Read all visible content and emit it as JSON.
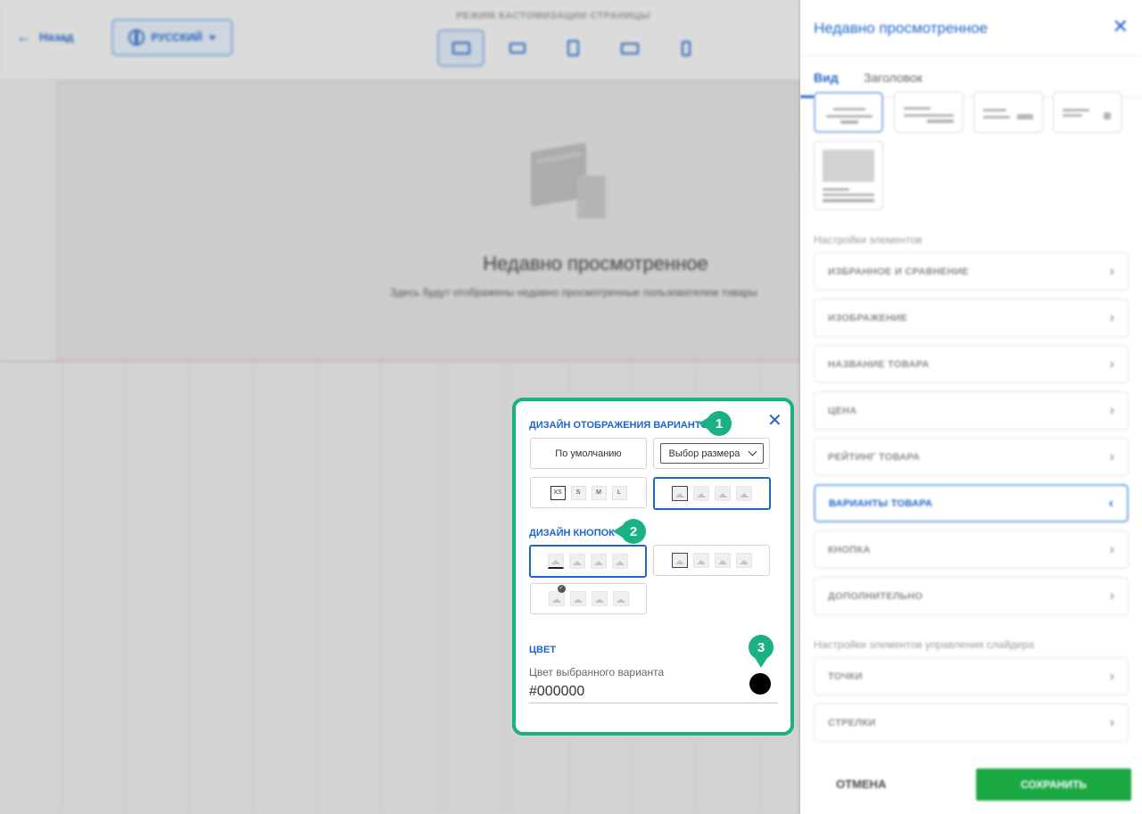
{
  "editor": {
    "back_label": "Назад",
    "language": "РУССКИЙ",
    "mode_title": "РЕЖИМ КАСТОМИЗАЦИИ СТРАНИЦЫ",
    "devices": [
      "desktop-icon",
      "laptop-icon",
      "tablet-icon",
      "tablet-landscape-icon",
      "phone-icon"
    ],
    "active_device": "desktop",
    "canvas": {
      "title": "Недавно просмотренное",
      "subtitle": "Здесь будут отображены недавно просмотренные пользователем товары"
    }
  },
  "panel": {
    "title": "Недавно просмотренное",
    "tabs": [
      {
        "label": "Вид",
        "active": true
      },
      {
        "label": "Заголовок",
        "active": false
      }
    ],
    "elements_section": "Настройки элементов",
    "items": [
      {
        "label": "ИЗБРАННОЕ И СРАВНЕНИЕ",
        "active": false
      },
      {
        "label": "ИЗОБРАЖЕНИЕ",
        "active": false
      },
      {
        "label": "НАЗВАНИЕ ТОВАРА",
        "active": false
      },
      {
        "label": "ЦЕНА",
        "active": false
      },
      {
        "label": "РЕЙТИНГ ТОВАРА",
        "active": false
      },
      {
        "label": "ВАРИАНТЫ ТОВАРА",
        "active": true
      },
      {
        "label": "КНОПКА",
        "active": false
      },
      {
        "label": "ДОПОЛНИТЕЛЬНО",
        "active": false
      }
    ],
    "slider_section": "Настройки элементов управления слайдера",
    "slider_items": [
      {
        "label": "ТОЧКИ"
      },
      {
        "label": "СТРЕЛКИ"
      }
    ],
    "cancel_label": "ОТМЕНА",
    "save_label": "СОХРАНИТЬ"
  },
  "popup": {
    "variants_heading": "ДИЗАЙН ОТОБРАЖЕНИЯ ВАРИАНТОВ",
    "default_option": "По умолчанию",
    "select_option": "Выбор размера",
    "sizes": [
      "XS",
      "S",
      "M",
      "L"
    ],
    "buttons_heading": "ДИЗАЙН КНОПОК",
    "color_heading": "ЦВЕТ",
    "color_label": "Цвет выбранного варианта",
    "color_value": "#000000",
    "badges": [
      "1",
      "2",
      "3"
    ]
  },
  "colors": {
    "accent": "#1f66c9",
    "callout": "#1ab184",
    "save": "#1aa843",
    "selected_variant": "#000000"
  }
}
